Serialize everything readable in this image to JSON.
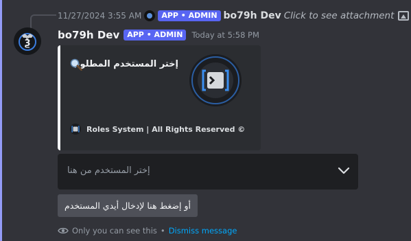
{
  "reply": {
    "timestamp": "11/27/2024 3:55 AM",
    "badge": "APP • ADMIN",
    "author": "bo79h Dev",
    "text": "Click to see attachment",
    "icon": "image-icon"
  },
  "message": {
    "author": "bo79h Dev",
    "badge": "APP • ADMIN",
    "timestamp": "Today at 5:58 PM",
    "accent_color": "#5865f2"
  },
  "embed": {
    "title": "إختر المستخدم المطلوب",
    "title_icon": "magnifier-icon",
    "footer": "Roles System | All Rights Reserved ©",
    "border_color": "#f2f3f5"
  },
  "select_menu": {
    "placeholder": "إختر المستخدم من هنا"
  },
  "button": {
    "label": "أو إضغط هنا لإدخال أيدي المستخدم"
  },
  "ephemeral": {
    "text": "Only you can see this",
    "separator": "•",
    "dismiss": "Dismiss message"
  }
}
